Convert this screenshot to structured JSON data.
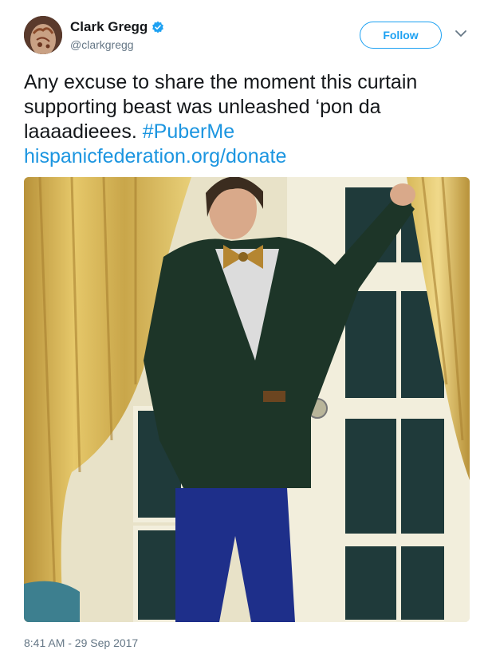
{
  "author": {
    "name": "Clark Gregg",
    "handle": "@clarkgregg",
    "verified_icon": "verified-badge-icon",
    "avatar_icon": "avatar"
  },
  "actions": {
    "follow_label": "Follow",
    "more_icon": "chevron-down-icon"
  },
  "tweet": {
    "text_line": "Any excuse to share the moment this curtain supporting beast was unleashed ‘pon da laaaadieees.",
    "hashtag": "#PuberMe",
    "link": "hispanicfederation.org/donate"
  },
  "media": {
    "type": "photo"
  },
  "meta": {
    "timestamp": "8:41 AM - 29 Sep 2017"
  },
  "colors": {
    "accent": "#1da1f2",
    "link": "#1b95e0",
    "text": "#14171a",
    "muted": "#657786"
  }
}
